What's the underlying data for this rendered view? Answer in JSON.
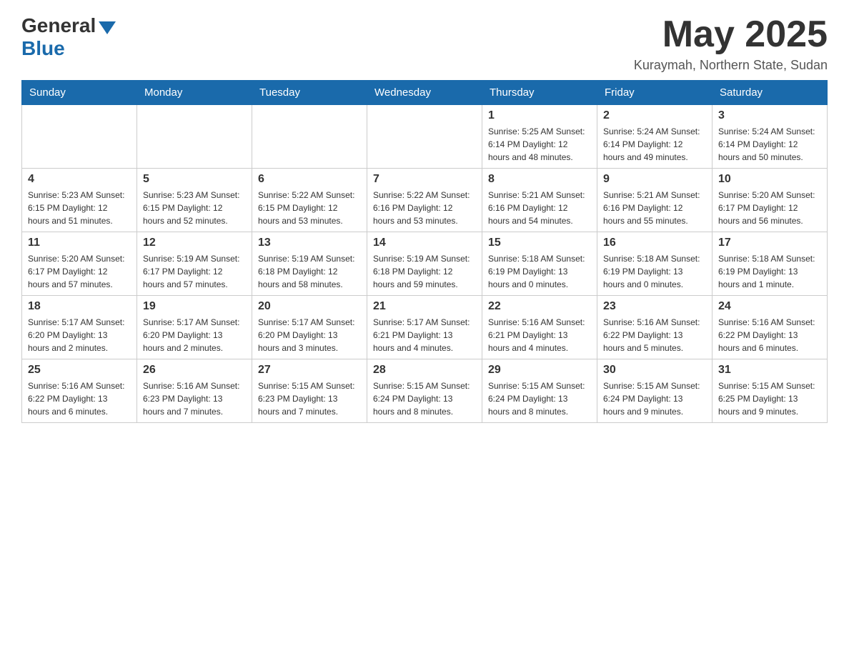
{
  "header": {
    "logo": {
      "general": "General",
      "blue": "Blue"
    },
    "title": "May 2025",
    "location": "Kuraymah, Northern State, Sudan"
  },
  "days_of_week": [
    "Sunday",
    "Monday",
    "Tuesday",
    "Wednesday",
    "Thursday",
    "Friday",
    "Saturday"
  ],
  "weeks": [
    [
      {
        "day": "",
        "info": ""
      },
      {
        "day": "",
        "info": ""
      },
      {
        "day": "",
        "info": ""
      },
      {
        "day": "",
        "info": ""
      },
      {
        "day": "1",
        "info": "Sunrise: 5:25 AM\nSunset: 6:14 PM\nDaylight: 12 hours\nand 48 minutes."
      },
      {
        "day": "2",
        "info": "Sunrise: 5:24 AM\nSunset: 6:14 PM\nDaylight: 12 hours\nand 49 minutes."
      },
      {
        "day": "3",
        "info": "Sunrise: 5:24 AM\nSunset: 6:14 PM\nDaylight: 12 hours\nand 50 minutes."
      }
    ],
    [
      {
        "day": "4",
        "info": "Sunrise: 5:23 AM\nSunset: 6:15 PM\nDaylight: 12 hours\nand 51 minutes."
      },
      {
        "day": "5",
        "info": "Sunrise: 5:23 AM\nSunset: 6:15 PM\nDaylight: 12 hours\nand 52 minutes."
      },
      {
        "day": "6",
        "info": "Sunrise: 5:22 AM\nSunset: 6:15 PM\nDaylight: 12 hours\nand 53 minutes."
      },
      {
        "day": "7",
        "info": "Sunrise: 5:22 AM\nSunset: 6:16 PM\nDaylight: 12 hours\nand 53 minutes."
      },
      {
        "day": "8",
        "info": "Sunrise: 5:21 AM\nSunset: 6:16 PM\nDaylight: 12 hours\nand 54 minutes."
      },
      {
        "day": "9",
        "info": "Sunrise: 5:21 AM\nSunset: 6:16 PM\nDaylight: 12 hours\nand 55 minutes."
      },
      {
        "day": "10",
        "info": "Sunrise: 5:20 AM\nSunset: 6:17 PM\nDaylight: 12 hours\nand 56 minutes."
      }
    ],
    [
      {
        "day": "11",
        "info": "Sunrise: 5:20 AM\nSunset: 6:17 PM\nDaylight: 12 hours\nand 57 minutes."
      },
      {
        "day": "12",
        "info": "Sunrise: 5:19 AM\nSunset: 6:17 PM\nDaylight: 12 hours\nand 57 minutes."
      },
      {
        "day": "13",
        "info": "Sunrise: 5:19 AM\nSunset: 6:18 PM\nDaylight: 12 hours\nand 58 minutes."
      },
      {
        "day": "14",
        "info": "Sunrise: 5:19 AM\nSunset: 6:18 PM\nDaylight: 12 hours\nand 59 minutes."
      },
      {
        "day": "15",
        "info": "Sunrise: 5:18 AM\nSunset: 6:19 PM\nDaylight: 13 hours\nand 0 minutes."
      },
      {
        "day": "16",
        "info": "Sunrise: 5:18 AM\nSunset: 6:19 PM\nDaylight: 13 hours\nand 0 minutes."
      },
      {
        "day": "17",
        "info": "Sunrise: 5:18 AM\nSunset: 6:19 PM\nDaylight: 13 hours\nand 1 minute."
      }
    ],
    [
      {
        "day": "18",
        "info": "Sunrise: 5:17 AM\nSunset: 6:20 PM\nDaylight: 13 hours\nand 2 minutes."
      },
      {
        "day": "19",
        "info": "Sunrise: 5:17 AM\nSunset: 6:20 PM\nDaylight: 13 hours\nand 2 minutes."
      },
      {
        "day": "20",
        "info": "Sunrise: 5:17 AM\nSunset: 6:20 PM\nDaylight: 13 hours\nand 3 minutes."
      },
      {
        "day": "21",
        "info": "Sunrise: 5:17 AM\nSunset: 6:21 PM\nDaylight: 13 hours\nand 4 minutes."
      },
      {
        "day": "22",
        "info": "Sunrise: 5:16 AM\nSunset: 6:21 PM\nDaylight: 13 hours\nand 4 minutes."
      },
      {
        "day": "23",
        "info": "Sunrise: 5:16 AM\nSunset: 6:22 PM\nDaylight: 13 hours\nand 5 minutes."
      },
      {
        "day": "24",
        "info": "Sunrise: 5:16 AM\nSunset: 6:22 PM\nDaylight: 13 hours\nand 6 minutes."
      }
    ],
    [
      {
        "day": "25",
        "info": "Sunrise: 5:16 AM\nSunset: 6:22 PM\nDaylight: 13 hours\nand 6 minutes."
      },
      {
        "day": "26",
        "info": "Sunrise: 5:16 AM\nSunset: 6:23 PM\nDaylight: 13 hours\nand 7 minutes."
      },
      {
        "day": "27",
        "info": "Sunrise: 5:15 AM\nSunset: 6:23 PM\nDaylight: 13 hours\nand 7 minutes."
      },
      {
        "day": "28",
        "info": "Sunrise: 5:15 AM\nSunset: 6:24 PM\nDaylight: 13 hours\nand 8 minutes."
      },
      {
        "day": "29",
        "info": "Sunrise: 5:15 AM\nSunset: 6:24 PM\nDaylight: 13 hours\nand 8 minutes."
      },
      {
        "day": "30",
        "info": "Sunrise: 5:15 AM\nSunset: 6:24 PM\nDaylight: 13 hours\nand 9 minutes."
      },
      {
        "day": "31",
        "info": "Sunrise: 5:15 AM\nSunset: 6:25 PM\nDaylight: 13 hours\nand 9 minutes."
      }
    ]
  ]
}
